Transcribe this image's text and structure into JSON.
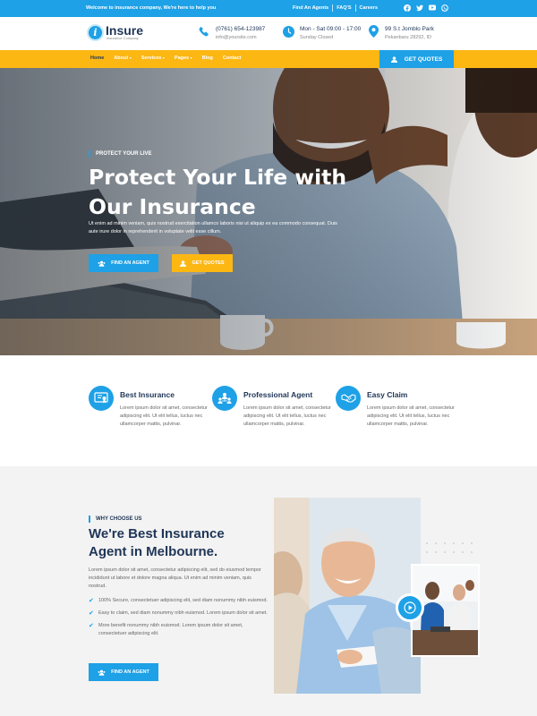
{
  "topbar": {
    "welcome": "Welcome to insurance company, We're here to help you",
    "links": [
      "Find An Agents",
      "FAQ'S",
      "Careers"
    ],
    "social_icons": [
      "facebook-icon",
      "twitter-icon",
      "youtube-icon",
      "whatsapp-icon"
    ]
  },
  "header": {
    "logo_letter": "i",
    "logo_name": "Insure",
    "logo_tagline": "Insurance Company",
    "phone": "(0761) 654-123987",
    "email": "info@yoursite.com",
    "hours": "Mon - Sat 09:00 - 17:00",
    "hours_note": "Sunday Closed",
    "address_line1": "99 S.t Jomblo Park",
    "address_line2": "Pekanbaru 28292, ID"
  },
  "nav": {
    "items": [
      "Home",
      "About",
      "Services",
      "Pages",
      "Blog",
      "Contact"
    ],
    "dropdown_arrow": "▾",
    "quote_button": "GET QUOTES"
  },
  "hero": {
    "tag": "PROTECT YOUR LIVE",
    "title": "Protect Your Life with Our Insurance",
    "description": "Ut enim ad minim veniam, quis nostrud exercitation ullamco laboris nisi ut aliquip ex ea commodo consequat. Duis aute irure dolor in reprehenderit in voluptate velit esse cillum.",
    "button_agent": "FIND AN AGENT",
    "button_quotes": "GET QUOTES"
  },
  "features": [
    {
      "icon": "certificate-icon",
      "title": "Best Insurance",
      "text": "Lorem ipsum dolor sit amet, consectetur adipiscing elit. Ut elit tellus, luctus nec ullamcorper mattis, pulvinar."
    },
    {
      "icon": "team-icon",
      "title": "Professional Agent",
      "text": "Lorem ipsum dolor sit amet, consectetur adipiscing elit. Ut elit tellus, luctus nec ullamcorper mattis, pulvinar."
    },
    {
      "icon": "handshake-icon",
      "title": "Easy Claim",
      "text": "Lorem ipsum dolor sit amet, consectetur adipiscing elit. Ut elit tellus, luctus nec ullamcorper mattis, pulvinar."
    }
  ],
  "why": {
    "tag": "WHY CHOOSE US",
    "title": "We're Best Insurance Agent in Melbourne.",
    "intro": "Lorem ipsum dolor sit amet, consectetur adipiscing elit, sed do eiusmod tempor incididunt ut labore et dolore magna aliqua. Ut enim ad minim veniam, quis nostrud.",
    "points": [
      "100% Secure, consectetuer adipiscing elit, sed diam nonummy nibh euismod.",
      "Easy to claim, sed diam nonummy nibh euismod. Lorem ipsum dolor sit amet.",
      "More benefit nonummy nibh euismod. Lorem ipsum dolor sit amet, consectetuer adipiscing elit."
    ],
    "check_glyph": "✔",
    "button": "FIND AN AGENT"
  },
  "colors": {
    "primary": "#1ea1e6",
    "accent": "#fcb713",
    "dark": "#1f3557"
  }
}
